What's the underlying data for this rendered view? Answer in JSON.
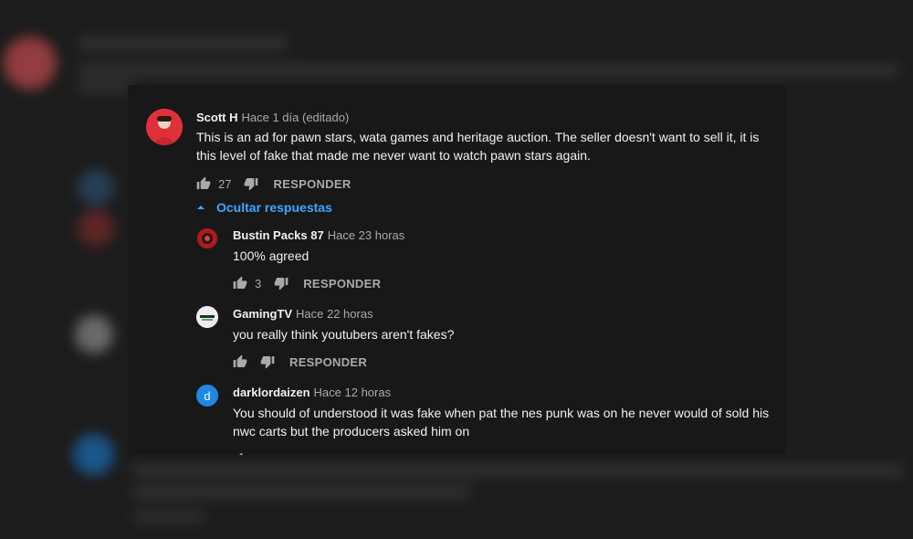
{
  "comment": {
    "author": "Scott H",
    "time": "Hace 1 día (editado)",
    "text": "This is an ad for pawn stars, wata games and heritage auction. The seller doesn't want to sell it, it is this level of fake that made me never want to watch pawn stars again.",
    "likes": "27",
    "reply_label": "RESPONDER",
    "avatar_color": "#e0313a"
  },
  "toggle_label": "Ocultar respuestas",
  "replies": [
    {
      "author": "Bustin Packs 87",
      "time": "Hace 23 horas",
      "text": "100% agreed",
      "likes": "3",
      "reply_label": "RESPONDER",
      "avatar_color": "#b51818"
    },
    {
      "author": "GamingTV",
      "time": "Hace 22 horas",
      "text": "you really think youtubers aren't fakes?",
      "likes": "",
      "reply_label": "RESPONDER",
      "avatar_color": "#e8e8e8"
    },
    {
      "author": "darklordaizen",
      "time": "Hace 12 horas",
      "text": "You should of understood it was fake when pat the nes punk was on he never would of sold his nwc carts but the producers asked him on",
      "avatar_letter": "d",
      "avatar_color": "#1e88e5"
    }
  ],
  "colors": {
    "link": "#3ea6ff",
    "text": "#f1f1f1",
    "secondary": "#aaaaaa",
    "panel": "#181818"
  }
}
